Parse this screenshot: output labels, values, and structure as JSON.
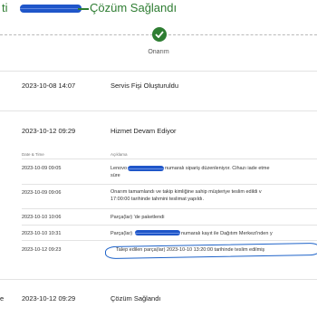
{
  "header": {
    "prefix": "ti",
    "title": "Çözüm Sağlandı"
  },
  "progress": {
    "step_label": "Onarım",
    "step_icon": "check-icon",
    "accent": "#2e7d32"
  },
  "events": [
    {
      "datetime": "2023-10-08 14:07",
      "title": "Servis Fişi Oluşturuldu"
    },
    {
      "datetime": "2023-10-12 09:29",
      "title": "Hizmet Devam Ediyor"
    }
  ],
  "log": {
    "col_date": "Date & Time",
    "col_desc": "Açıklama",
    "rows": [
      {
        "datetime": "2023-10-09 09:05",
        "line1_a": "Lenovo",
        "line1_b": "numaralı sipariş düzenleniyor. Cihazı iade etme",
        "line2": "süre"
      },
      {
        "datetime": "2023-10-09 09:06",
        "line1": "Onarım tamamlandı ve takip kimliğine sahip müşteriye teslim edildi v",
        "line2": "17:00:00 tarihinde tahmini teslimat yapıldı."
      },
      {
        "datetime": "2023-10-10 10:06",
        "line1": "Parça(lar) 'de paketlendi"
      },
      {
        "datetime": "2023-10-10 10:31",
        "line1_a": "Parça(lar)",
        "line1_b": "numaralı kayıt ile Dağıtım Merkezi'nden y"
      },
      {
        "datetime": "2023-10-12 09:23",
        "line1": "Talep edilen parça(lar) 2023-10-10 13:20:00 tarihinde teslim edilmiş"
      }
    ]
  },
  "final_event": {
    "prefix": "e",
    "datetime": "2023-10-12 09:29",
    "title": "Çözüm Sağlandı"
  }
}
